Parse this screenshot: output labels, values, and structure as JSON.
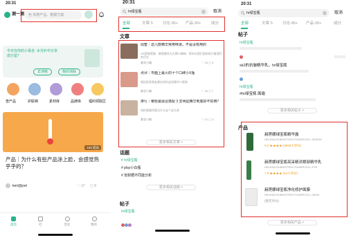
{
  "p1": {
    "time": "20:31",
    "logo": "测一测",
    "search_placeholder": "色 热搜产品、敷膜方案",
    "banner_line1": "今日在你的小毒舌· 水光针中分享",
    "banner_line2": "成分鉴？",
    "banner_btn1": "去测敏",
    "banner_btn2": "我的测肤",
    "categories": [
      "查产品",
      "护肤锦",
      "素材库",
      "品牌库",
      "福利领取区"
    ],
    "article_badge": "164 成员",
    "article_title": "产品｜为什么有些产品涂上脸，会感觉热乎乎的？",
    "author": "keri@joel",
    "likes": "17",
    "comments": "9",
    "tabs": [
      "首页",
      "社",
      "活动",
      "我的"
    ]
  },
  "p2": {
    "time": "20:31",
    "query": "hr绿宝瓶",
    "cancel": "取消",
    "tabs": [
      "全部",
      "文章·5",
      "讨论·86+",
      "产品·99+",
      "成分"
    ],
    "section_articles": "文章",
    "articles": [
      {
        "title": "闺蜜｜这几款精华常用味道，不是没有用的",
        "desc": "HR是赫莲娜，赫莲娜作为大牌小精神，常年在我们面前吸引着我们的目光",
        "author": "美妆小编",
        "likes": "26",
        "comments": "5"
      },
      {
        "title": "点评｜市面上最火的十个口碑小X瓶",
        "desc": "相信很多朋友都在研究这些精华小瓶装",
        "author": "美妆小编",
        "likes": "45",
        "comments": "7"
      },
      {
        "title": "排行｜哪些最适合搭配 3 支明星精华到底好不好用？",
        "desc": "同样是精华瓶为什么这个这么贵",
        "author": "美妆小编",
        "likes": "12",
        "comments": "3"
      }
    ],
    "more_articles": "更多相关文章 >",
    "section_topics": "话题",
    "topics": [
      "# hr绿宝瓶",
      "# play小白瓶",
      "# 安耐晒不同能分析"
    ],
    "more_topics": "更多相关话题 >",
    "section_posts": "帖子",
    "post_tag": "hr绿宝瓶"
  },
  "p3": {
    "time": "20:31",
    "query": "hr绿宝瓶",
    "cancel": "取消",
    "tabs": [
      "全部",
      "文章·5",
      "讨论·86+",
      "产品·99+",
      "成分"
    ],
    "section_posts": "帖子",
    "post1_tag": "hr绿宝瓶",
    "post1_text": "sk2的抗皱精华乳，hr绿宝瓶",
    "post2_tag": "hr绿宝瓶",
    "post2_text": "#hr绿宝瓶 面霜",
    "more_posts": "更多相关帖子 >",
    "section_products": "产品",
    "products": [
      {
        "name": "赫莲娜绿宝瓶精华露",
        "en": "HELENA RUBINSTEIN POWERCELL SERUM",
        "meta": "9.0 ★★★★ (3990人评分)"
      },
      {
        "name": "赫莲娜绿宝瓶亮采精灵眼部精华乳",
        "en": "HELENA RUBINSTEIN POWERCELL EYE",
        "meta": "7.8 ★★★★ (54人评分)"
      },
      {
        "name": "赫莲娜绿宝瓶净化修护面膜",
        "en": "HELENA RUBINSTEIN POWERCELL MASK",
        "meta": "(暂无评分)"
      }
    ],
    "more_products": "更多相关产品 >"
  }
}
